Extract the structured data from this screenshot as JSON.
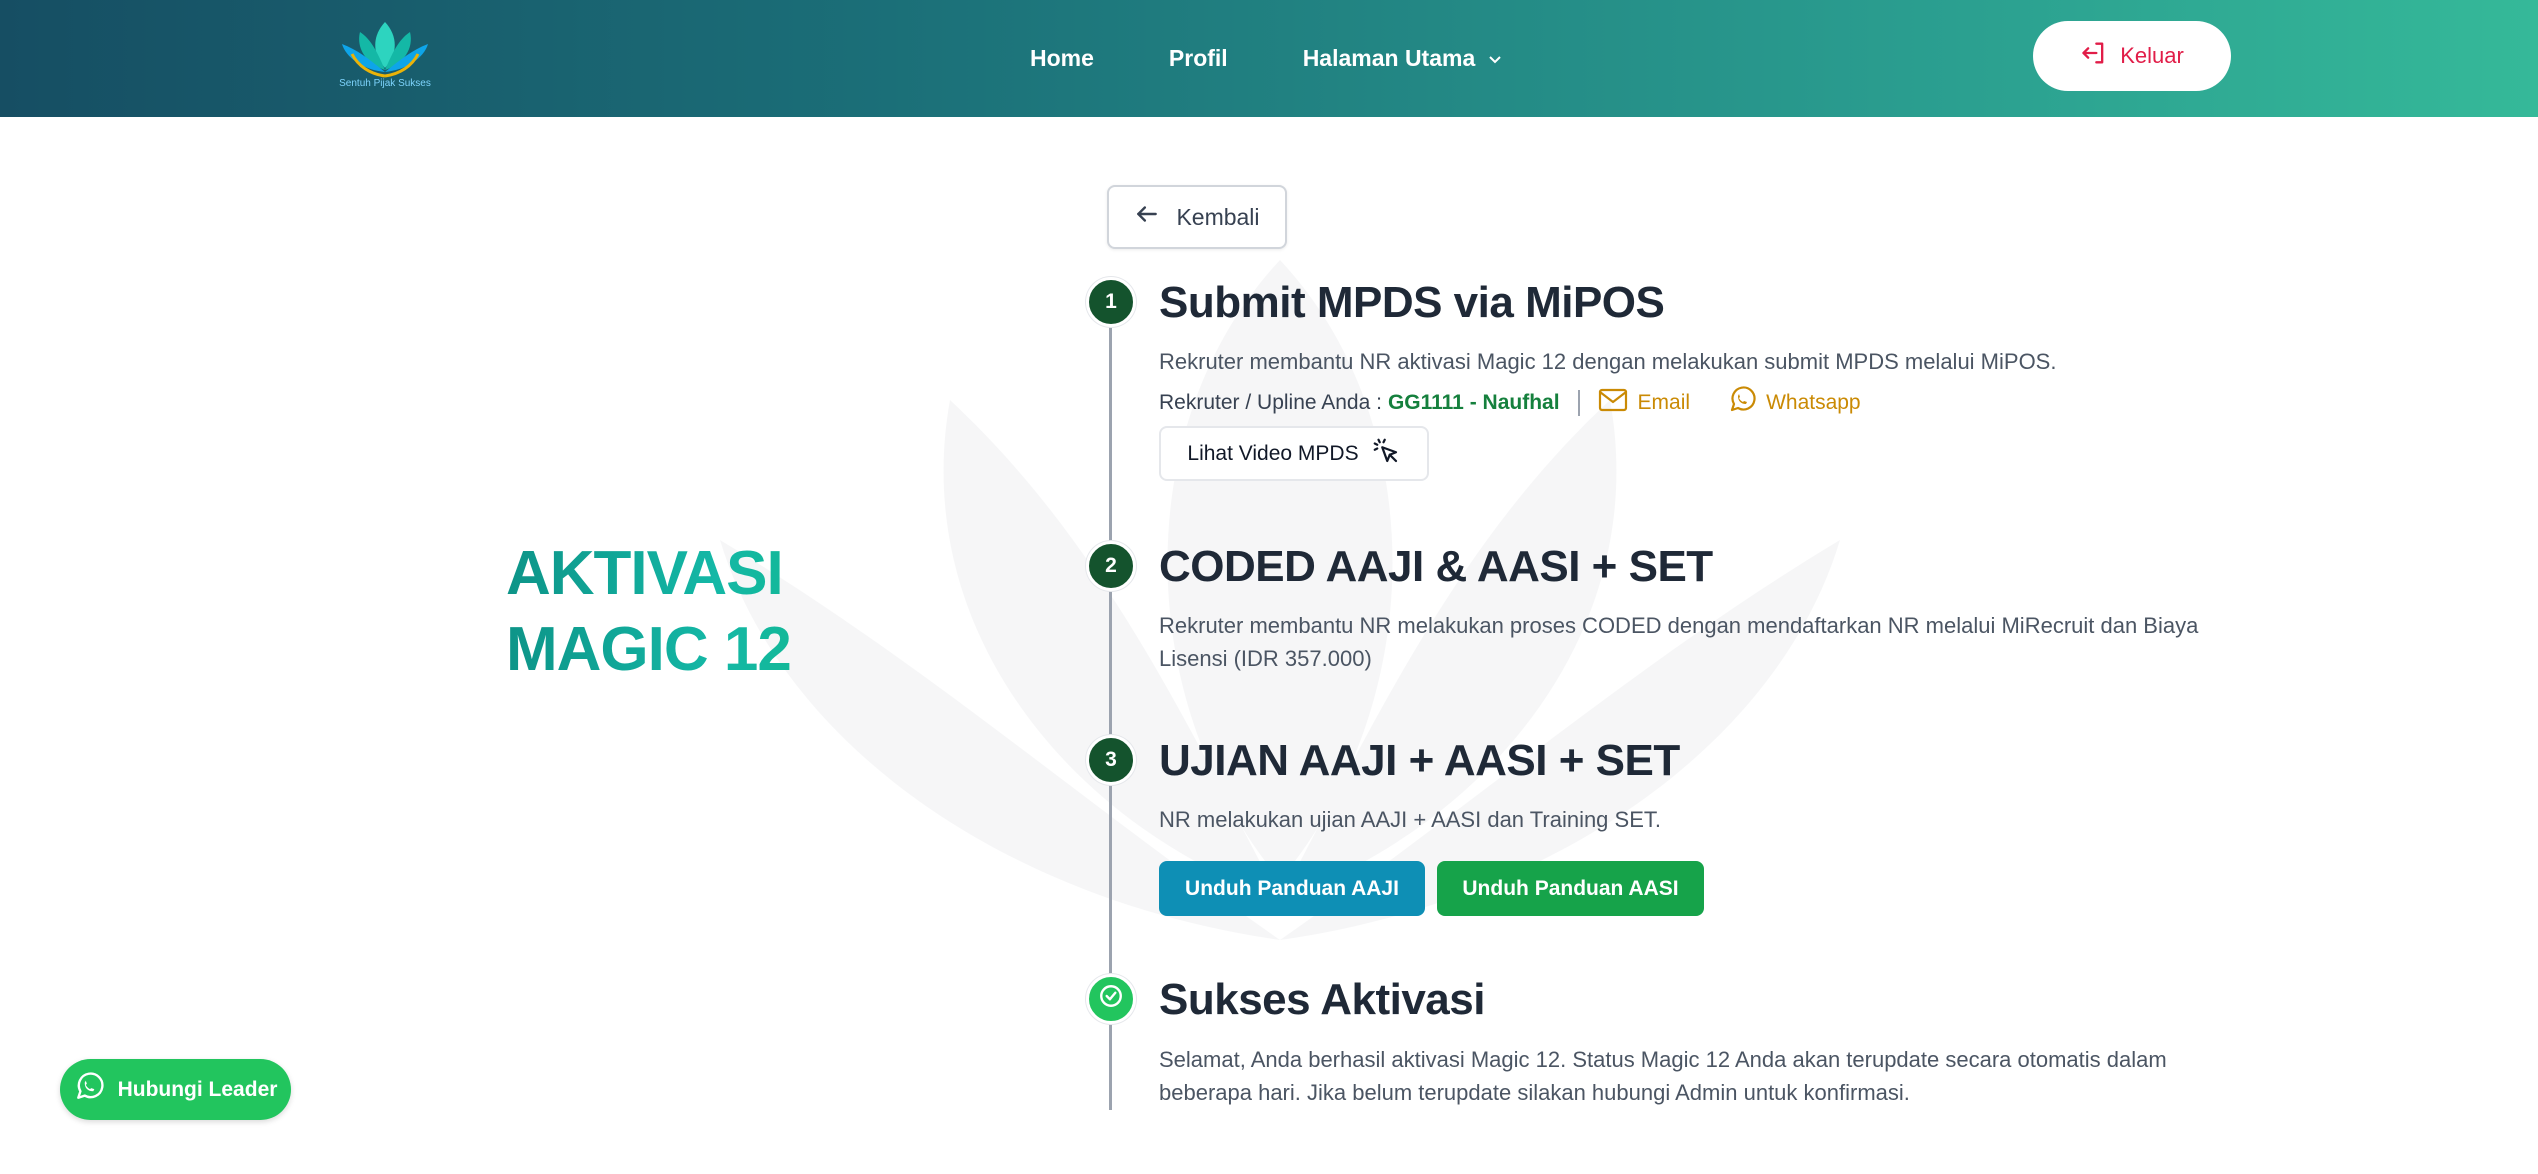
{
  "header": {
    "logo_text": "Sentuh Pijak Sukses",
    "nav": [
      {
        "label": "Home"
      },
      {
        "label": "Profil"
      },
      {
        "label": "Halaman Utama"
      }
    ],
    "logout_label": "Keluar"
  },
  "back_label": "Kembali",
  "hero": {
    "line1": "AKTIVASI",
    "line2": "MAGIC 12"
  },
  "steps": [
    {
      "number": "1",
      "title": "Submit MPDS via MiPOS",
      "desc": "Rekruter membantu NR aktivasi Magic 12 dengan melakukan submit MPDS melalui MiPOS.",
      "recruiter_label": "Rekruter / Upline Anda :",
      "recruiter_code": "GG1111 - Naufhal",
      "email_label": "Email",
      "whatsapp_label": "Whatsapp",
      "video_label": "Lihat Video MPDS"
    },
    {
      "number": "2",
      "title": "CODED AAJI & AASI + SET",
      "desc": "Rekruter membantu NR melakukan proses CODED dengan mendaftarkan NR melalui MiRecruit dan Biaya Lisensi (IDR 357.000)"
    },
    {
      "number": "3",
      "title": "UJIAN AAJI + AASI + SET",
      "desc": "NR melakukan ujian AAJI + AASI dan Training SET.",
      "download_aaji": "Unduh Panduan AAJI",
      "download_aasi": "Unduh Panduan AASI"
    },
    {
      "title": "Sukses Aktivasi",
      "desc": "Selamat, Anda berhasil aktivasi Magic 12. Status Magic 12 Anda akan terupdate secara otomatis dalam beberapa hari. Jika belum terupdate silakan hubungi Admin untuk konfirmasi."
    }
  ],
  "float_whatsapp_label": "Hubungi Leader",
  "colors": {
    "header_start": "#164e63",
    "header_end": "#35b999",
    "step_badge": "#14532d",
    "success_badge": "#22c55e",
    "logout_text": "#e11d48",
    "aaji_button": "#0e8fb5",
    "aasi_button": "#16a34a",
    "contact_link": "#ca8a04"
  }
}
